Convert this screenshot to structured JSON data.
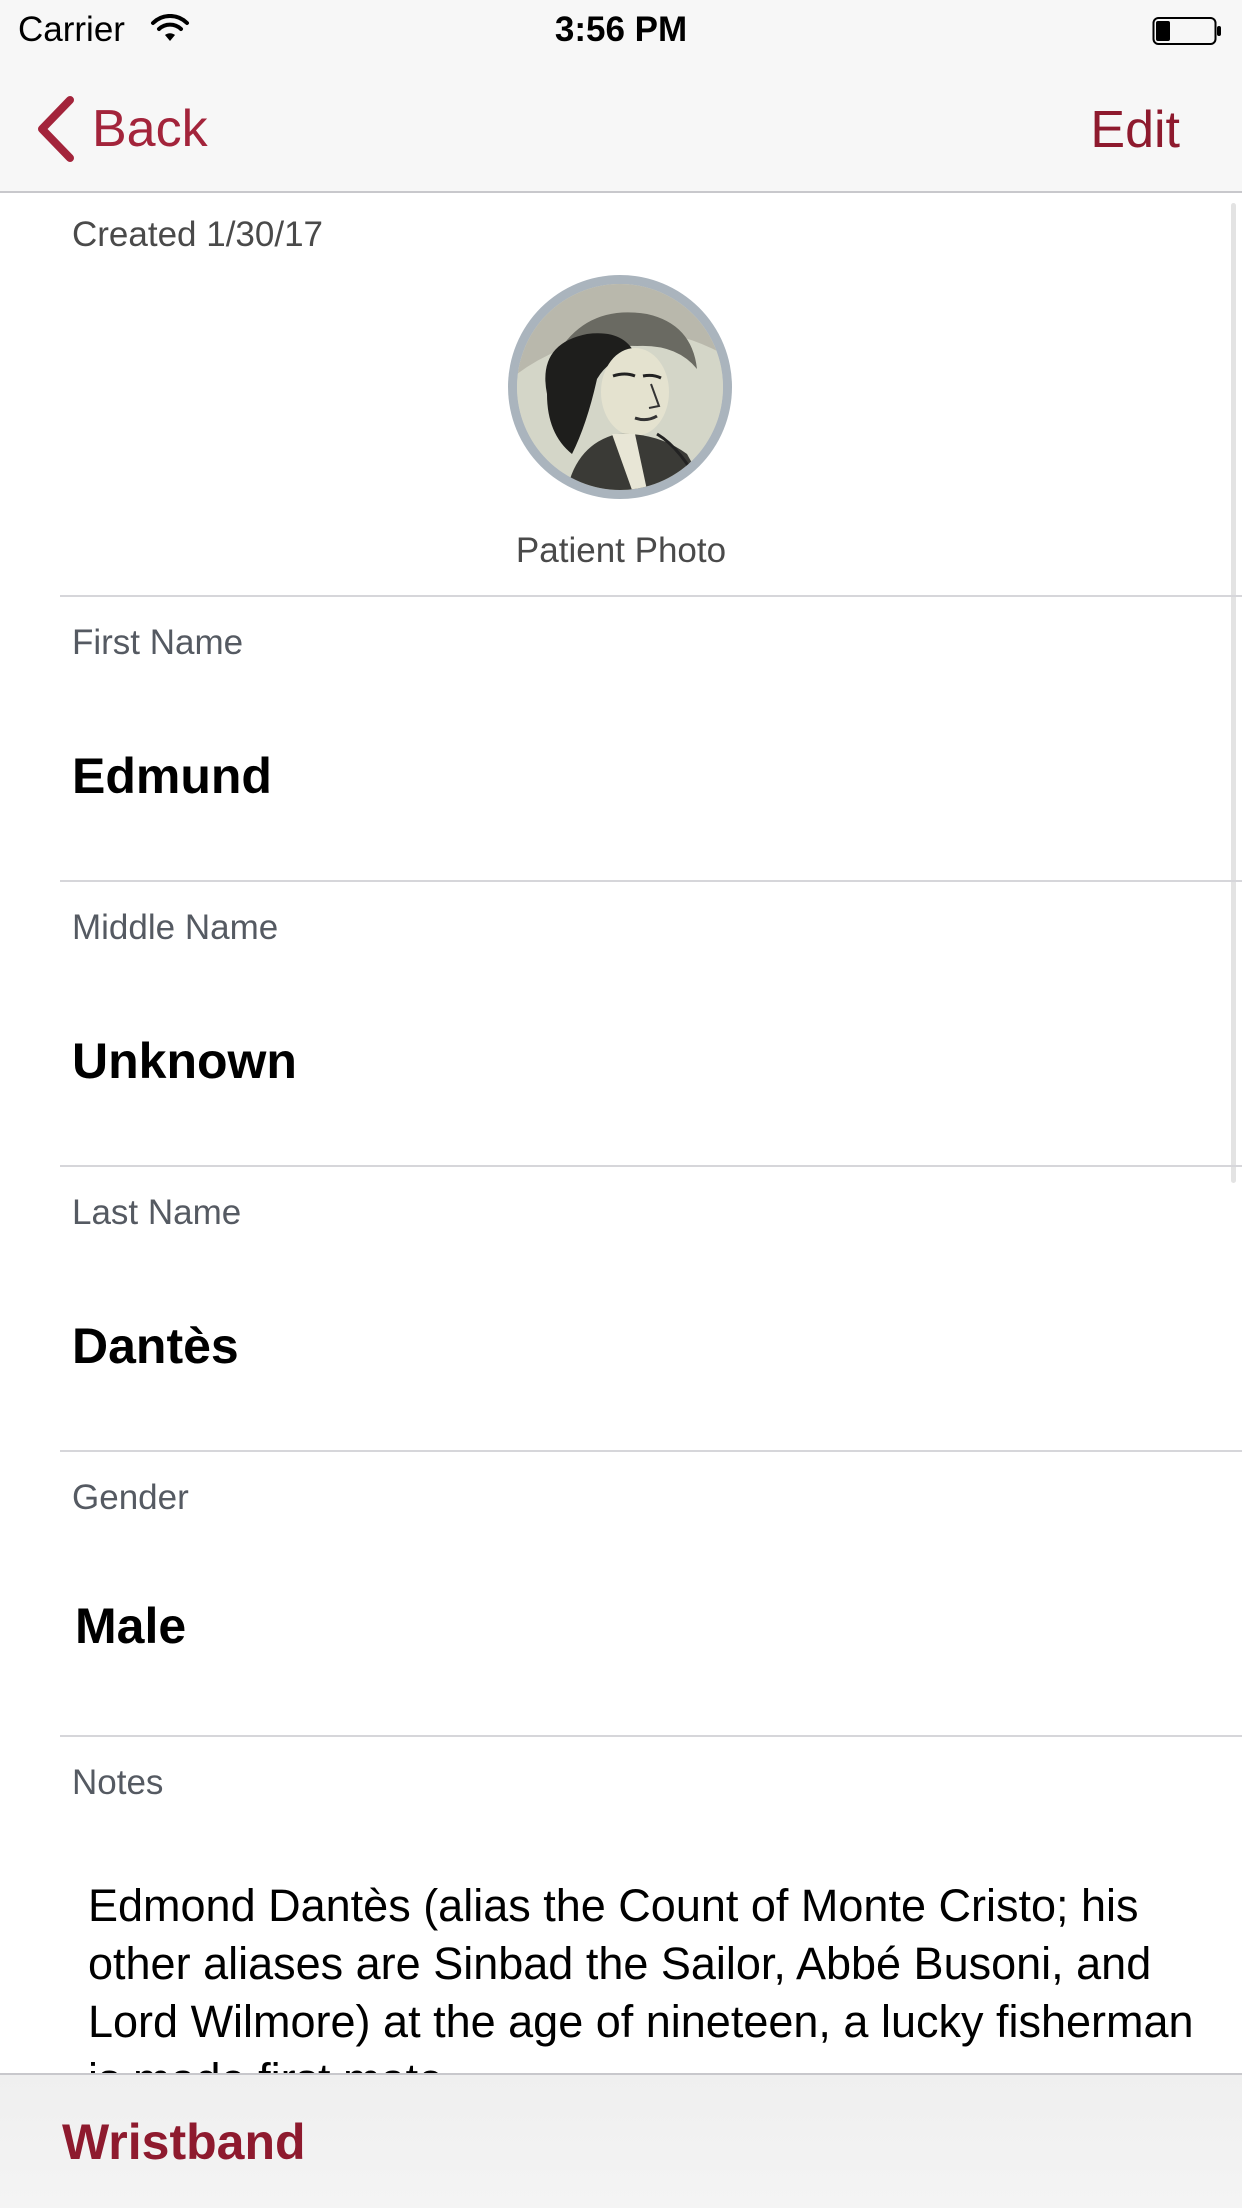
{
  "status_bar": {
    "carrier": "Carrier",
    "time": "3:56 PM",
    "wifi_icon": "wifi-icon",
    "battery_icon": "battery-icon"
  },
  "nav": {
    "back_label": "Back",
    "edit_label": "Edit",
    "accent_color": "#a3243b"
  },
  "record": {
    "created": "Created 1/30/17",
    "photo_label": "Patient Photo"
  },
  "fields": {
    "first_name": {
      "label": "First Name",
      "value": "Edmund"
    },
    "middle_name": {
      "label": "Middle Name",
      "value": "Unknown"
    },
    "last_name": {
      "label": "Last Name",
      "value": "Dantès"
    },
    "gender": {
      "label": "Gender",
      "value": "Male"
    },
    "notes": {
      "label": "Notes",
      "value": "Edmond Dantès (alias the Count of Monte Cristo; his other aliases are Sinbad the Sailor, Abbé Busoni, and Lord Wilmore) at the age of nineteen, a lucky fisherman is made first mate"
    }
  },
  "toolbar": {
    "wristband_label": "Wristband"
  }
}
